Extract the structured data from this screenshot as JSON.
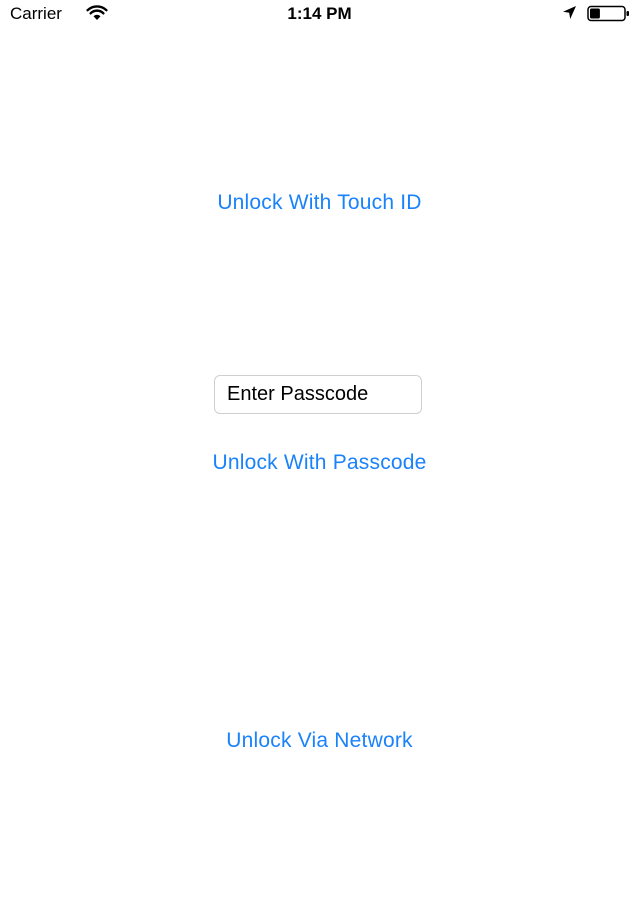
{
  "status_bar": {
    "carrier": "Carrier",
    "time": "1:14 PM",
    "wifi_icon": "wifi-icon",
    "location_icon": "location-arrow-icon",
    "battery_icon": "battery-icon",
    "battery_level": 0.3
  },
  "main": {
    "touch_id_label": "Unlock With Touch ID",
    "passcode_placeholder": "Enter Passcode",
    "passcode_label": "Unlock With Passcode",
    "network_label": "Unlock Via Network"
  },
  "colors": {
    "accent": "#1a82fb",
    "background": "#ffffff"
  }
}
